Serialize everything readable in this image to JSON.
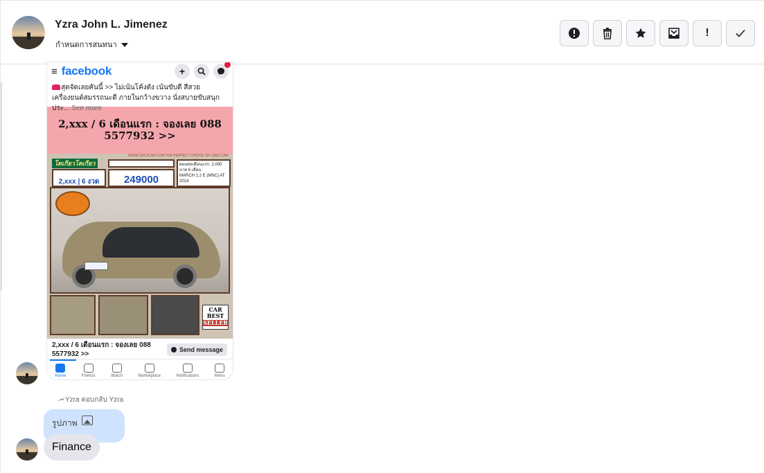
{
  "contact": {
    "name": "Yzra John L. Jimenez",
    "assign_label": "กำหนดการสนทนา"
  },
  "actions": [
    {
      "name": "report-spam-button",
      "icon": "alert-circle-icon"
    },
    {
      "name": "delete-button",
      "icon": "trash-icon"
    },
    {
      "name": "star-button",
      "icon": "star-icon"
    },
    {
      "name": "move-to-inbox-button",
      "icon": "inbox-icon"
    },
    {
      "name": "mark-important-button",
      "icon": "exclamation-icon",
      "label": "!"
    },
    {
      "name": "mark-done-button",
      "icon": "checkmark-icon"
    }
  ],
  "shared_post": {
    "app_logo": "facebook",
    "menu_glyph": "≡",
    "post_text": "สุดจัดเลยคันนี้ >> ไม่เน้นโค้งดัง เน้นขับดี สีสวย เครื่องยนต์สมรรถนะดี ภายในกว้างขวาง นั่งสบายขับสนุก ประ...",
    "see_more": "See more",
    "headline_line1": "2,xxx / 6 เดือนแรก : จองเลย 088",
    "headline_line2": "5577932 >>",
    "ad_strip": "WWW.CRC2CAR.COM THE PERFECT CHOICE OF USED CAR",
    "brand_badge": "โตเกียวโตเกียว",
    "down_payment": "2,xxx | 6 งวดแรก",
    "price": "249000",
    "promo_text": "ผ่อนต่อเดือนแรก: 2,000 บาท 6 เดือน",
    "promo_amount": "2,000",
    "model_text": "MARCH 1.2 E (MNC) AT 2014",
    "best_seller_top": "CAR",
    "best_seller_mid": "BEST",
    "best_seller_bottom": "SELLER",
    "footer_line1": "2,xxx / 6 เดือนแรก : จองเลย 088",
    "footer_line2": "5577932 >>",
    "send_message": "Send message",
    "nav": [
      "Home",
      "Friends",
      "Watch",
      "Marketplace",
      "Notifications",
      "Menu"
    ]
  },
  "reply": {
    "replied_label": "Yzra ตอบกลับ Yzra",
    "quoted_label": "รูปภาพ",
    "message": "Finance"
  },
  "colors": {
    "facebook_blue": "#1877f2",
    "quote_bubble": "#cfe3ff",
    "message_bubble": "#e4e6eb",
    "ad_pink": "#f5a6ac"
  }
}
